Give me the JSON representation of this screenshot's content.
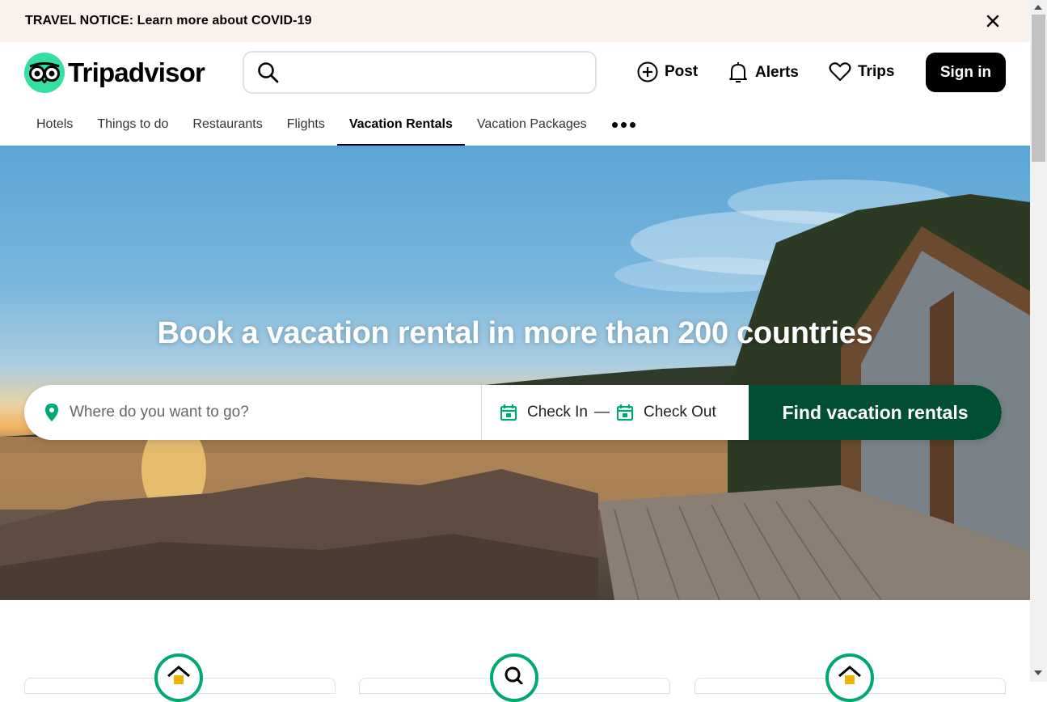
{
  "notice": {
    "text": "TRAVEL NOTICE: Learn more about COVID-19",
    "close_icon": "close-icon"
  },
  "header": {
    "logo_text": "Tripadvisor",
    "search_placeholder": "",
    "post_label": "Post",
    "alerts_label": "Alerts",
    "trips_label": "Trips",
    "signin_label": "Sign in"
  },
  "tabs": [
    {
      "label": "Hotels",
      "active": false
    },
    {
      "label": "Things to do",
      "active": false
    },
    {
      "label": "Restaurants",
      "active": false
    },
    {
      "label": "Flights",
      "active": false
    },
    {
      "label": "Vacation Rentals",
      "active": true
    },
    {
      "label": "Vacation Packages",
      "active": false
    }
  ],
  "hero": {
    "title": "Book a vacation rental in more than 200 countries",
    "where_placeholder": "Where do you want to go?",
    "check_in_label": "Check In",
    "dash": "—",
    "check_out_label": "Check Out",
    "find_button_label": "Find vacation rentals"
  },
  "colors": {
    "brand_green": "#34e0a1",
    "button_dark_green": "#004f32",
    "accent_green": "#00aa6c",
    "notice_bg": "#faf1ed"
  }
}
